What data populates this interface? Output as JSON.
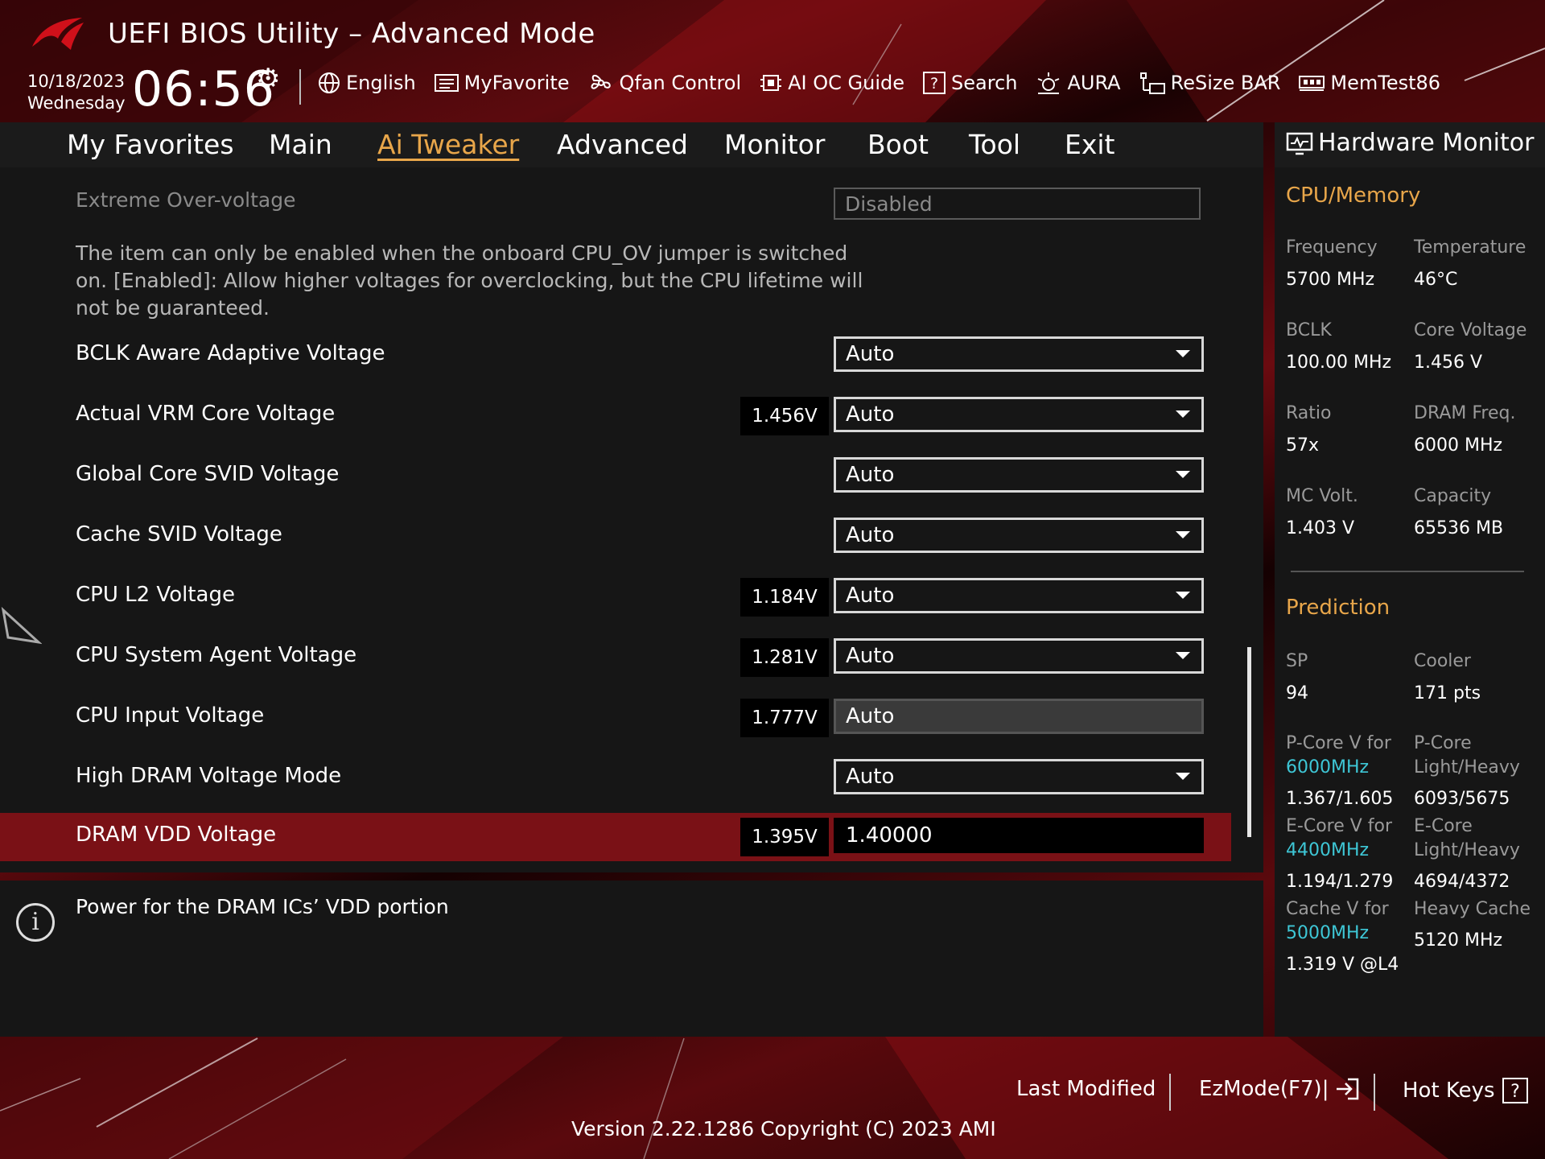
{
  "header": {
    "title": "UEFI BIOS Utility – Advanced Mode",
    "date": "10/18/2023",
    "weekday": "Wednesday",
    "time": "06:56",
    "tools": [
      {
        "label": "English",
        "icon": "globe-icon"
      },
      {
        "label": "MyFavorite",
        "icon": "favorite-list-icon"
      },
      {
        "label": "Qfan Control",
        "icon": "fan-icon"
      },
      {
        "label": "AI OC Guide",
        "icon": "chip-guide-icon"
      },
      {
        "label": "Search",
        "icon": "help-search-icon"
      },
      {
        "label": "AURA",
        "icon": "aura-light-icon"
      },
      {
        "label": "ReSize BAR",
        "icon": "resize-bar-icon"
      },
      {
        "label": "MemTest86",
        "icon": "memory-module-icon"
      }
    ]
  },
  "nav": {
    "tabs": [
      {
        "label": "My Favorites"
      },
      {
        "label": "Main"
      },
      {
        "label": "Ai Tweaker",
        "active": true
      },
      {
        "label": "Advanced"
      },
      {
        "label": "Monitor"
      },
      {
        "label": "Boot"
      },
      {
        "label": "Tool"
      },
      {
        "label": "Exit"
      }
    ]
  },
  "settings": {
    "extreme_ov": {
      "label": "Extreme Over-voltage",
      "value": "Disabled"
    },
    "description": "The item can only be enabled when the onboard CPU_OV jumper is switched on. [Enabled]: Allow higher voltages for overclocking, but the CPU lifetime will not be guaranteed.",
    "rows": [
      {
        "label": "BCLK Aware Adaptive Voltage",
        "readout": "",
        "value": "Auto"
      },
      {
        "label": "Actual VRM Core Voltage",
        "readout": "1.456V",
        "value": "Auto"
      },
      {
        "label": "Global Core SVID Voltage",
        "readout": "",
        "value": "Auto"
      },
      {
        "label": "Cache SVID Voltage",
        "readout": "",
        "value": "Auto"
      },
      {
        "label": "CPU L2 Voltage",
        "readout": "1.184V",
        "value": "Auto"
      },
      {
        "label": "CPU System Agent Voltage",
        "readout": "1.281V",
        "value": "Auto"
      },
      {
        "label": "CPU Input Voltage",
        "readout": "1.777V",
        "value": "Auto"
      },
      {
        "label": "High DRAM Voltage Mode",
        "readout": "",
        "value": "Auto"
      },
      {
        "label": "DRAM VDD Voltage",
        "readout": "1.395V",
        "value": "1.40000"
      }
    ]
  },
  "help": {
    "text": "Power for the DRAM ICs’ VDD portion"
  },
  "hw_monitor": {
    "title": "Hardware Monitor",
    "cpu_memory": {
      "heading": "CPU/Memory",
      "frequency_label": "Frequency",
      "frequency": "5700 MHz",
      "temperature_label": "Temperature",
      "temperature": "46°C",
      "bclk_label": "BCLK",
      "bclk": "100.00 MHz",
      "core_voltage_label": "Core Voltage",
      "core_voltage": "1.456 V",
      "ratio_label": "Ratio",
      "ratio": "57x",
      "dram_freq_label": "DRAM Freq.",
      "dram_freq": "6000 MHz",
      "mc_volt_label": "MC Volt.",
      "mc_volt": "1.403 V",
      "capacity_label": "Capacity",
      "capacity": "65536 MB"
    },
    "prediction": {
      "heading": "Prediction",
      "sp_label": "SP",
      "sp": "94",
      "cooler_label": "Cooler",
      "cooler": "171 pts",
      "pcore_v_label": "P-Core V for",
      "pcore_v_freq": "6000MHz",
      "pcore_v": "1.367/1.605",
      "pcore_lh_label1": "P-Core",
      "pcore_lh_label2": "Light/Heavy",
      "pcore_lh": "6093/5675",
      "ecore_v_label": "E-Core V for",
      "ecore_v_freq": "4400MHz",
      "ecore_v": "1.194/1.279",
      "ecore_lh_label1": "E-Core",
      "ecore_lh_label2": "Light/Heavy",
      "ecore_lh": "4694/4372",
      "cache_v_label": "Cache V for",
      "cache_v_freq": "5000MHz",
      "cache_v": "1.319 V @L4",
      "heavy_cache_label": "Heavy Cache",
      "heavy_cache": "5120 MHz"
    }
  },
  "footer": {
    "last_modified": "Last Modified",
    "ezmode": "EzMode(F7)|",
    "hotkeys": "Hot Keys",
    "version": "Version 2.22.1286 Copyright (C) 2023 AMI"
  }
}
